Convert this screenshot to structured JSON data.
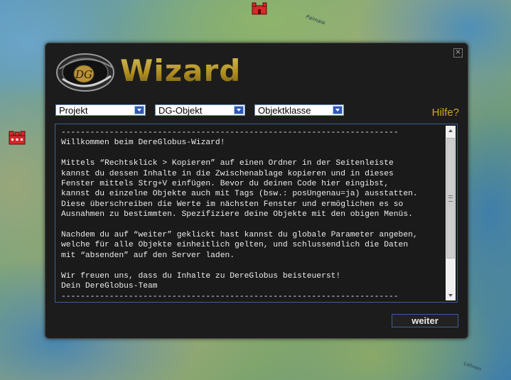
{
  "map": {
    "labels": [
      "Palmaia",
      "Lohnen"
    ]
  },
  "wizard": {
    "title": "Wizard",
    "logo_text": "DG",
    "close_symbol": "×",
    "dropdowns": {
      "projekt": "Projekt",
      "dg_objekt": "DG-Objekt",
      "objektklasse": "Objektklasse"
    },
    "help_label": "Hilfe?",
    "message_lines": [
      "----------------------------------------------------------------------",
      "Willkommen beim DereGlobus-Wizard!",
      "",
      "Mittels “Rechtsklick > Kopieren” auf einen Ordner in der Seitenleiste",
      "kannst du dessen Inhalte in die Zwischenablage kopieren und in dieses",
      "Fenster mittels Strg+V einfügen. Bevor du deinen Code hier eingibst,",
      "kannst du einzelne Objekte auch mit Tags (bsw.: posUngenau=ja) ausstatten.",
      "Diese überschreiben die Werte im nächsten Fenster und ermöglichen es so",
      "Ausnahmen zu bestimmten. Spezifiziere deine Objekte mit den obigen Menüs.",
      "",
      "Nachdem du auf “weiter” geklickt hast kannst du globale Parameter angeben,",
      "welche für alle Objekte einheitlich gelten, und schlussendlich die Daten",
      "mit “absenden” auf den Server laden.",
      "",
      "Wir freuen uns, dass du Inhalte zu DereGlobus beisteuerst!",
      "Dein DereGlobus-Team",
      "----------------------------------------------------------------------"
    ],
    "next_button": "weiter"
  },
  "icons": {
    "castle": "castle-icon",
    "close": "close-icon",
    "dropdown": "chevron-down-icon"
  },
  "colors": {
    "accent_gold": "#d4a52b",
    "border_blue": "#3b5f9a",
    "castle_red": "#d8282a"
  }
}
